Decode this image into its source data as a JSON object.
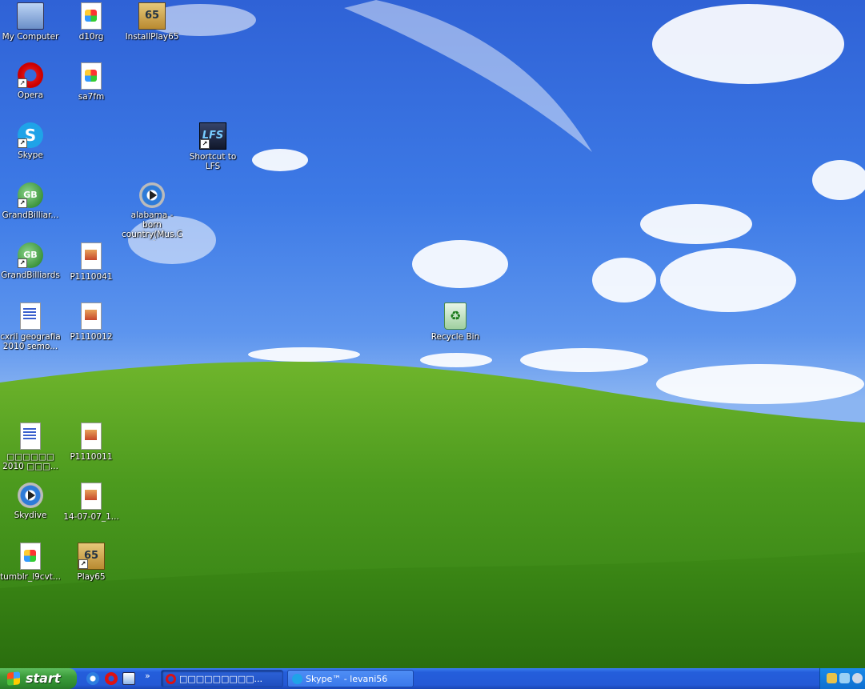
{
  "desktop": {
    "icons": [
      {
        "label": "My Computer",
        "icon": "my-computer-icon"
      },
      {
        "label": "d10rg",
        "icon": "image-file-icon"
      },
      {
        "label": "InstallPlay65",
        "icon": "installer-icon"
      },
      {
        "label": "Opera",
        "icon": "opera-icon",
        "shortcut": true
      },
      {
        "label": "sa7fm",
        "icon": "image-file-icon"
      },
      {
        "label": "Skype",
        "icon": "skype-icon",
        "shortcut": true
      },
      {
        "label": "Shortcut to LFS",
        "icon": "lfs-icon",
        "shortcut": true
      },
      {
        "label": "GrandBilliar...",
        "icon": "billiards-icon",
        "shortcut": true
      },
      {
        "label": "alabama - born country(Mus.G e)",
        "icon": "media-file-icon"
      },
      {
        "label": "GrandBilliards",
        "icon": "billiards-icon",
        "shortcut": true
      },
      {
        "label": "P1110041",
        "icon": "photo-file-icon"
      },
      {
        "label": "cxril geografia 2010 semo...",
        "icon": "word-document-icon"
      },
      {
        "label": "P1110012",
        "icon": "photo-file-icon"
      },
      {
        "label": "Recycle Bin",
        "icon": "recycle-bin-icon"
      },
      {
        "label": "□□□□□□ 2010 □□□...",
        "icon": "word-document-icon"
      },
      {
        "label": "P1110011",
        "icon": "photo-file-icon"
      },
      {
        "label": "Skydive",
        "icon": "media-file-icon"
      },
      {
        "label": "14-07-07_1...",
        "icon": "photo-file-icon"
      },
      {
        "label": "tumblr_l9cvt...",
        "icon": "image-file-icon"
      },
      {
        "label": "Play65",
        "icon": "installer-icon",
        "shortcut": true
      }
    ]
  },
  "taskbar": {
    "start_label": "start",
    "quick_launch": [
      "internet-explorer-icon",
      "opera-icon",
      "show-desktop-icon"
    ],
    "overflow_label": "»",
    "tasks": [
      {
        "label": "□□□□□□□□□...",
        "icon": "opera-icon",
        "active": true
      },
      {
        "label": "Skype™ - levani56",
        "icon": "skype-icon",
        "active": false
      }
    ],
    "tray_icons": [
      "network-icon",
      "volume-icon",
      "clock-icon"
    ]
  },
  "colors": {
    "taskbar_blue": "#245edb",
    "start_green": "#3c9c3c",
    "sky_blue": "#3d7ae6",
    "grass_green": "#4c9a1e"
  }
}
